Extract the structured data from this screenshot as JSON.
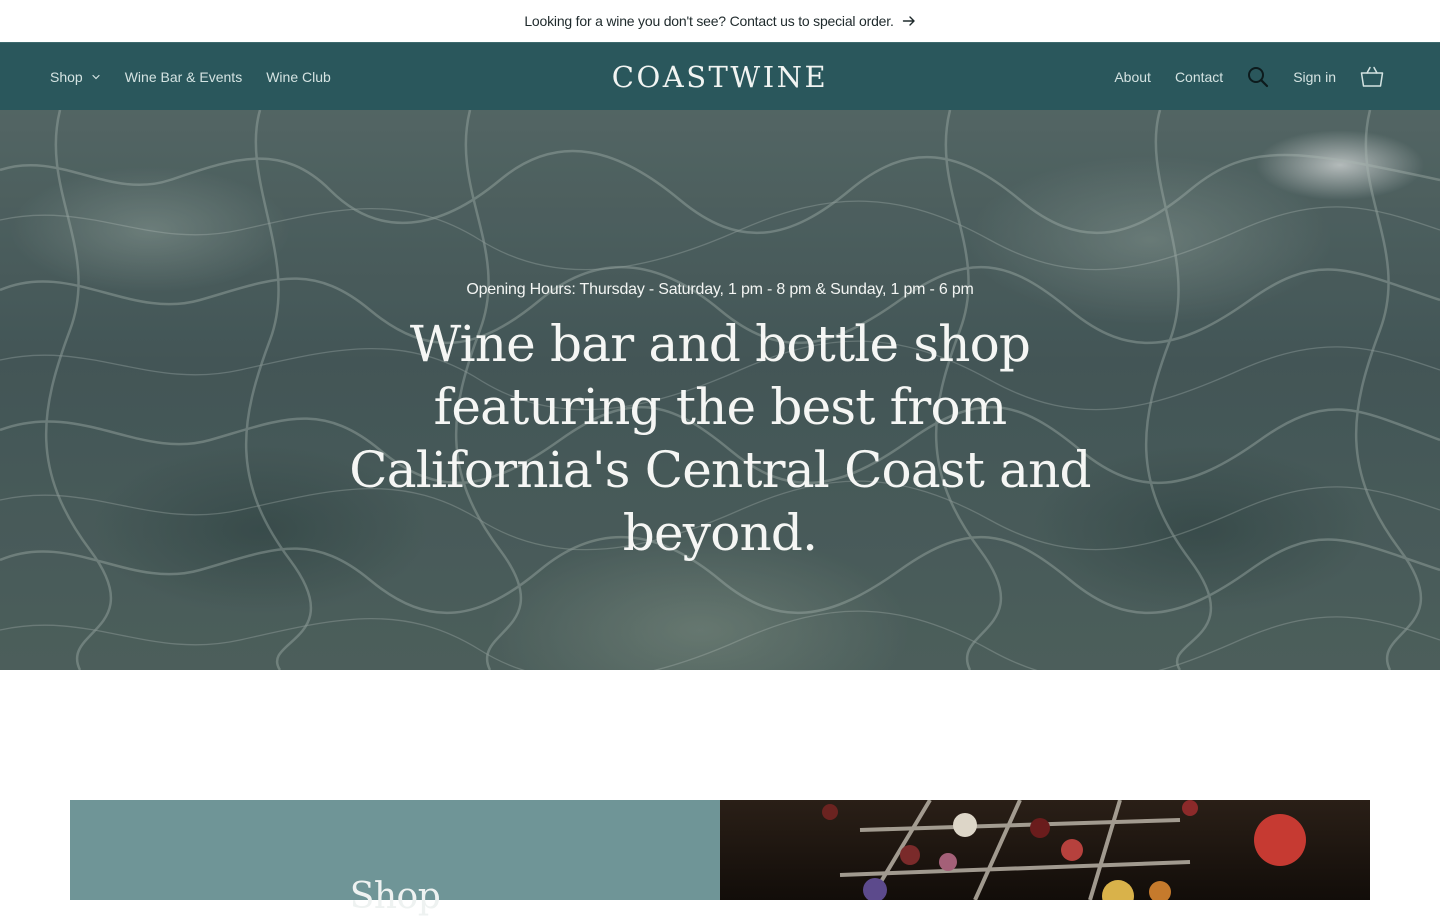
{
  "announcement": {
    "text": "Looking for a wine you don't see? Contact us to special order.",
    "arrow_icon": "arrow-right-icon"
  },
  "header": {
    "nav_left": [
      {
        "label": "Shop",
        "has_dropdown": true
      },
      {
        "label": "Wine Bar & Events"
      },
      {
        "label": "Wine Club"
      }
    ],
    "logo": "COASTWINE",
    "nav_right": {
      "about": "About",
      "contact": "Contact",
      "search_icon": "search-icon",
      "sign_in": "Sign in",
      "cart_icon": "cart-icon"
    }
  },
  "hero": {
    "hours": "Opening Hours: Thursday - Saturday, 1 pm - 8 pm & Sunday, 1 pm - 6 pm",
    "headline": "Wine bar and bottle shop featuring the best from California's Central Coast and beyond."
  },
  "feature": {
    "title": "Shop"
  },
  "colors": {
    "header_bg": "#2a575c",
    "panel_bg": "#6f9597",
    "text_light": "#f5f6f4",
    "announcement_text": "#1f2a2c"
  }
}
